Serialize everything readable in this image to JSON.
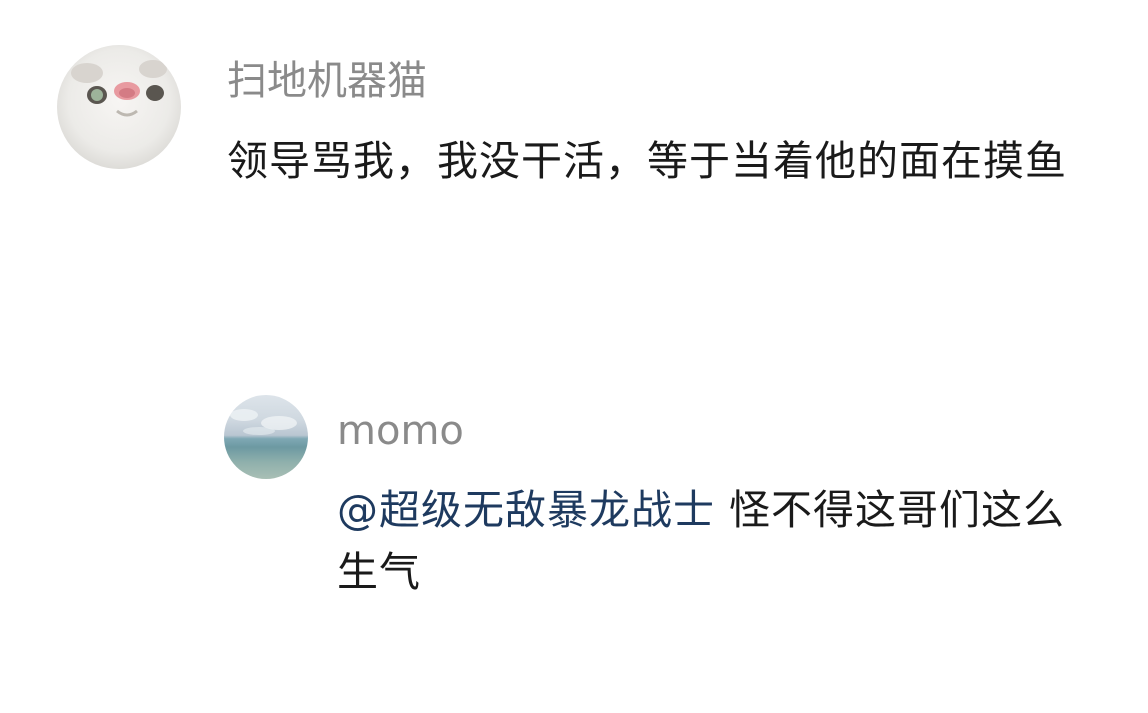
{
  "comments": [
    {
      "username": "扫地机器猫",
      "text": "领导骂我，我没干活，等于当着他的面在摸鱼",
      "avatar_icon": "cat-face-avatar"
    }
  ],
  "reply": {
    "username": "momo",
    "mention": "@超级无敌暴龙战士",
    "text": " 怪不得这哥们这么生气",
    "avatar_icon": "seascape-avatar"
  },
  "colors": {
    "username": "#8a8a8a",
    "text": "#1a1a1a",
    "mention": "#1e3a5f",
    "background": "#ffffff"
  }
}
